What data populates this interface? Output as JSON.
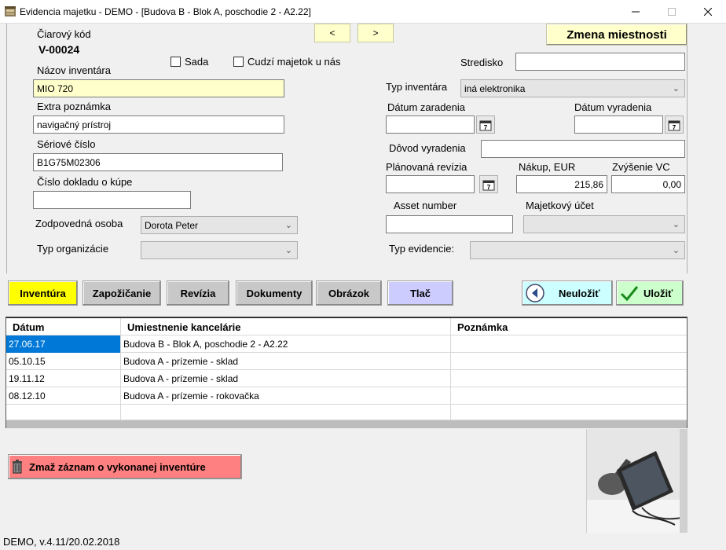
{
  "window": {
    "title": "Evidencia majetku - DEMO - [Budova B - Blok A, poschodie 2 - A2.22]"
  },
  "form": {
    "barcode_label": "Čiarový kód",
    "barcode_value": "V-00024",
    "prev_label": "<",
    "next_label": ">",
    "change_room_label": "Zmena miestnosti",
    "set_label": "Sada",
    "foreign_label": "Cudzí majetok u nás",
    "center_label": "Stredisko",
    "center_value": "",
    "name_label": "Názov inventára",
    "name_value": "MIO 720",
    "type_label": "Typ inventára",
    "type_value": "iná elektronika",
    "note_label": "Extra poznámka",
    "note_value": "navigačný prístroj",
    "date_in_label": "Dátum zaradenia",
    "date_in_value": "",
    "date_out_label": "Dátum vyradenia",
    "date_out_value": "",
    "serial_label": "Sériové číslo",
    "serial_value": "B1G75M02306",
    "reason_label": "Dôvod vyradenia",
    "reason_value": "",
    "doc_label": "Číslo dokladu o kúpe",
    "doc_value": "",
    "planned_label": "Plánovaná revízia",
    "planned_value": "",
    "purchase_label": "Nákup, EUR",
    "purchase_value": "215,86",
    "increase_label": "Zvýšenie VC",
    "increase_value": "0,00",
    "responsible_label": "Zodpovedná osoba",
    "responsible_value": "Dorota Peter",
    "asset_label": "Asset number",
    "asset_value": "",
    "account_label": "Majetkový účet",
    "account_value": "",
    "org_label": "Typ organizácie",
    "org_value": "",
    "evid_label": "Typ evidencie:",
    "evid_value": ""
  },
  "tabs": {
    "inventory": "Inventúra",
    "loan": "Zapožičanie",
    "revision": "Revízia",
    "documents": "Dokumenty",
    "picture": "Obrázok",
    "print": "Tlač",
    "cancel": "Neuložiť",
    "save": "Uložiť"
  },
  "colors": {
    "inventory": "#ffff00",
    "print": "#ccccff",
    "cancel": "#ccffff",
    "save": "#ccffcc",
    "delete": "#ff8080"
  },
  "grid": {
    "headers": [
      "Dátum",
      "Umiestnenie kancelárie",
      "Poznámka"
    ],
    "rows": [
      [
        "27.06.17",
        "Budova B - Blok A, poschodie 2 - A2.22",
        ""
      ],
      [
        "05.10.15",
        "Budova A - prízemie - sklad",
        ""
      ],
      [
        "19.11.12",
        "Budova A - prízemie - sklad",
        ""
      ],
      [
        "08.12.10",
        "Budova A - prízemie - rokovačka",
        ""
      ],
      [
        "",
        "",
        ""
      ]
    ]
  },
  "actions": {
    "delete_label": "Zmaž záznam o vykonanej inventúre"
  },
  "status": {
    "version": "DEMO, v.4.11/20.02.2018"
  }
}
